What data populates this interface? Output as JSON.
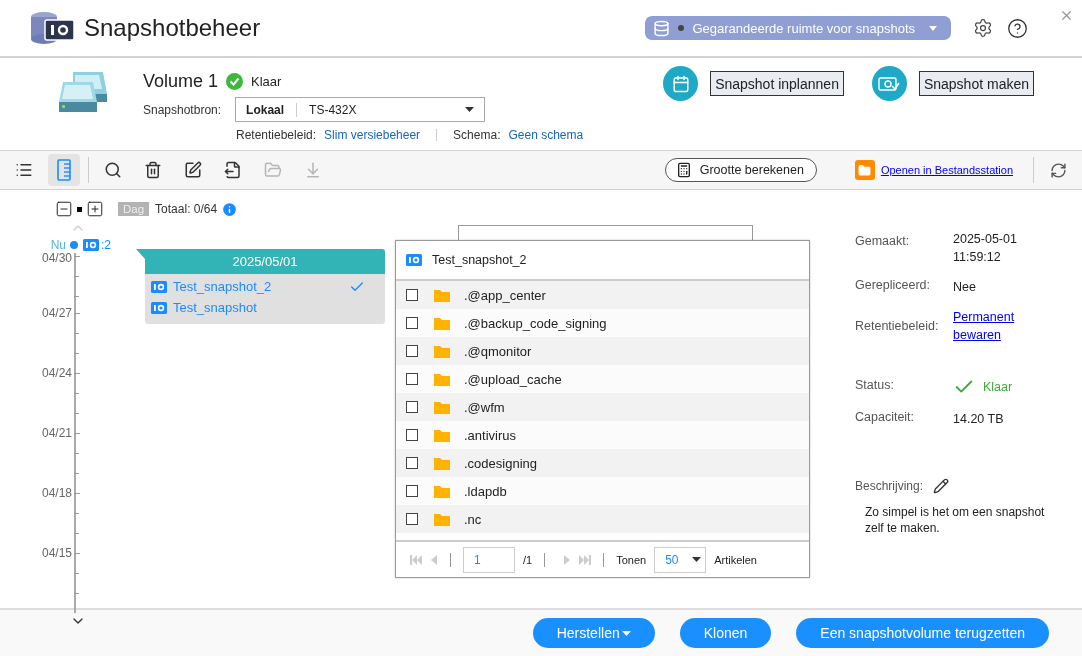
{
  "app": {
    "title": "Snapshotbeheer"
  },
  "space_menu": {
    "label": "Gegarandeerde ruimte voor snapshots"
  },
  "volume": {
    "name": "Volume 1",
    "status": "Klaar",
    "source_label": "Snapshotbron:",
    "source_type": "Lokaal",
    "source_device": "TS-432X",
    "retention_label": "Retentiebeleid:",
    "retention_value": "Slim versiebeheer",
    "schedule_label": "Schema:",
    "schedule_value": "Geen schema"
  },
  "actions": [
    {
      "label": "Snapshot inplannen",
      "kind": "schedule"
    },
    {
      "label": "Snapshot maken",
      "kind": "take"
    }
  ],
  "toolbar": {
    "tools": [
      {
        "kind": "list",
        "selected": false,
        "disabled": false
      },
      {
        "kind": "timeline",
        "selected": true,
        "disabled": false
      },
      {
        "kind": "search",
        "selected": false,
        "disabled": false
      },
      {
        "kind": "delete",
        "selected": false,
        "disabled": false
      },
      {
        "kind": "edit",
        "selected": false,
        "disabled": false
      },
      {
        "kind": "export",
        "selected": false,
        "disabled": false
      },
      {
        "kind": "open",
        "selected": false,
        "disabled": true
      },
      {
        "kind": "download",
        "selected": false,
        "disabled": true
      }
    ],
    "calc_button": "Grootte berekenen",
    "open_link": "Openen in Bestandsstation"
  },
  "timeline": {
    "scale": "Dag",
    "total": "Totaal: 0/64",
    "now_label": "Nu",
    "now_count": ":2",
    "dates": [
      "04/30",
      "04/27",
      "04/24",
      "04/21",
      "04/18",
      "04/15"
    ]
  },
  "group": {
    "date": "2025/05/01",
    "snapshots": [
      {
        "name": "Test_snapshot_2",
        "selected": true
      },
      {
        "name": "Test_snapshot",
        "selected": false
      }
    ]
  },
  "browser": {
    "title": "Test_snapshot_2",
    "files": [
      {
        "name": ".@app_center",
        "checked": false
      },
      {
        "name": ".@backup_code_signing",
        "checked": false
      },
      {
        "name": ".@qmonitor",
        "checked": false
      },
      {
        "name": ".@upload_cache",
        "checked": false
      },
      {
        "name": ".@wfm",
        "checked": false
      },
      {
        "name": ".antivirus",
        "checked": false
      },
      {
        "name": ".codesigning",
        "checked": false
      },
      {
        "name": ".ldapdb",
        "checked": false
      },
      {
        "name": ".nc",
        "checked": false
      }
    ],
    "pager": {
      "page": "1",
      "of": "/1",
      "show_label": "Tonen",
      "per_page": "50",
      "items_label": "Artikelen"
    }
  },
  "details": {
    "fields": [
      {
        "label": "Gemaakt:",
        "value": "2025-05-01 11:59:12",
        "kind": "text"
      },
      {
        "label": "Gerepliceerd:",
        "value": "Nee",
        "kind": "text"
      },
      {
        "label": "Retentiebeleid:",
        "value": "Permanent bewaren",
        "kind": "link"
      },
      {
        "label": "Status:",
        "value": "Klaar",
        "kind": "status"
      },
      {
        "label": "Capaciteit:",
        "value": "14.20 TB",
        "kind": "text"
      }
    ],
    "description_label": "Beschrijving:",
    "description": "Zo simpel is het om een snapshot zelf te maken."
  },
  "footer": {
    "buttons": [
      {
        "label": "Herstellen",
        "kind": "menu"
      },
      {
        "label": "Klonen",
        "kind": "plain"
      },
      {
        "label": "Een snapshotvolume terugzetten",
        "kind": "plain"
      }
    ]
  }
}
